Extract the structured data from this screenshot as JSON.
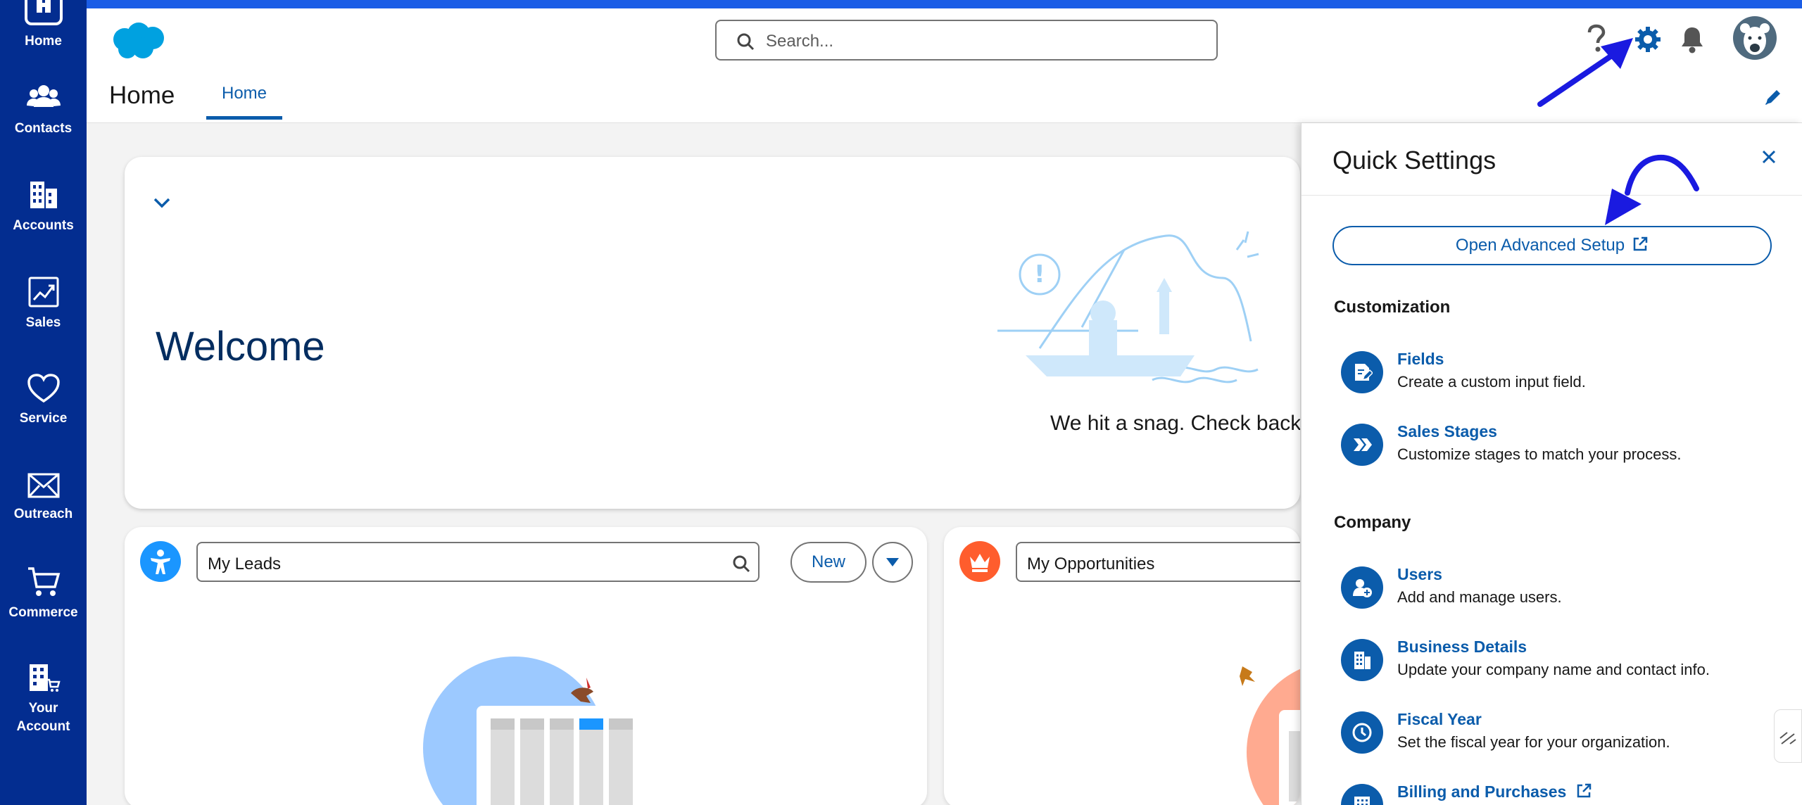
{
  "nav": {
    "items": [
      {
        "label": "Home"
      },
      {
        "label": "Contacts"
      },
      {
        "label": "Accounts"
      },
      {
        "label": "Sales"
      },
      {
        "label": "Service"
      },
      {
        "label": "Outreach"
      },
      {
        "label": "Commerce"
      },
      {
        "label": "Your Account"
      }
    ]
  },
  "header": {
    "search_placeholder": "Search...",
    "page_title": "Home",
    "tab_label": "Home"
  },
  "welcome": {
    "title": "Welcome",
    "message": "We hit a snag. Check back l"
  },
  "leads": {
    "list_name": "My Leads",
    "new_label": "New"
  },
  "opportunities": {
    "list_name": "My Opportunities"
  },
  "quick_settings": {
    "title": "Quick Settings",
    "advanced_setup_label": "Open Advanced Setup",
    "customization_heading": "Customization",
    "company_heading": "Company",
    "items": [
      {
        "title": "Fields",
        "desc": "Create a custom input field."
      },
      {
        "title": "Sales Stages",
        "desc": "Customize stages to match your process."
      },
      {
        "title": "Users",
        "desc": "Add and manage users."
      },
      {
        "title": "Business Details",
        "desc": "Update your company name and contact info."
      },
      {
        "title": "Fiscal Year",
        "desc": "Set the fiscal year for your organization."
      },
      {
        "title": "Billing and Purchases",
        "desc": ""
      }
    ]
  },
  "colors": {
    "nav_bg": "#032d90",
    "brand_blue": "#0b5cab",
    "top_stripe": "#1b5de6",
    "annotation_arrow": "#1a1ae0",
    "leads_icon": "#1b96ff",
    "opps_icon": "#ff5d2d"
  }
}
